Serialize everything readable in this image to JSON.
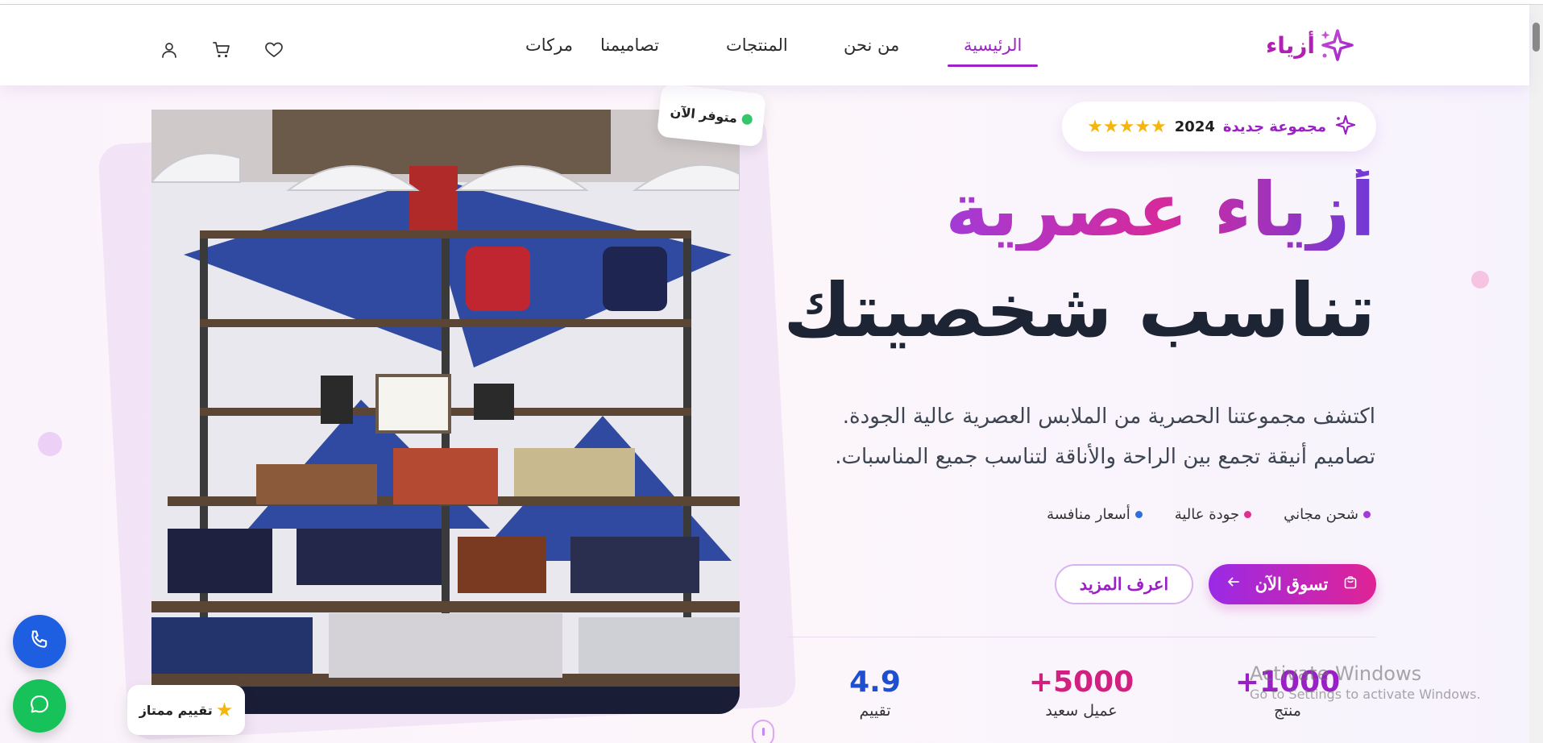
{
  "brand": {
    "name": "أزياء",
    "color": "#b21fb4"
  },
  "nav": {
    "items": [
      {
        "label": "الرئيسية",
        "active": true
      },
      {
        "label": "من نحن",
        "active": false
      },
      {
        "label": "المنتجات",
        "active": false
      },
      {
        "label": "تصاميمنا",
        "active": false
      },
      {
        "label": "مركات",
        "active": false
      }
    ]
  },
  "header_icons": [
    "wishlist-heart-icon",
    "cart-icon",
    "user-icon"
  ],
  "hero": {
    "tag": {
      "text": "مجموعة جديدة",
      "year": "2024",
      "stars": "★★★★★"
    },
    "title_line1": "أزياء عصرية",
    "title_line2": "تناسب شخصيتك",
    "description_line1": "اكتشف مجموعتنا الحصرية من الملابس العصرية عالية الجودة.",
    "description_line2": "تصاميم أنيقة تجمع بين الراحة والأناقة لتناسب جميع المناسبات.",
    "features": [
      {
        "label": "شحن مجاني",
        "color": "#a63ad6"
      },
      {
        "label": "جودة عالية",
        "color": "#e0308f"
      },
      {
        "label": "أسعار منافسة",
        "color": "#2e6fe0"
      }
    ],
    "primary_button": "تسوق الآن",
    "secondary_button": "اعرف المزيد",
    "stats": [
      {
        "value": "+1000",
        "label": "منتج",
        "color": "#9a1fc4"
      },
      {
        "value": "+5000",
        "label": "عميل سعيد",
        "color": "#d1207f"
      },
      {
        "value": "4.9",
        "label": "تقييم",
        "color": "#1f4fd1"
      }
    ]
  },
  "image_badges": {
    "available": "متوفر الآن",
    "rating": "تقييم ممتاز",
    "rating_icon": "★"
  },
  "floating_buttons": [
    "phone-icon",
    "chat-icon"
  ],
  "watermark": {
    "title": "Activate Windows",
    "subtitle": "Go to Settings to activate Windows."
  }
}
